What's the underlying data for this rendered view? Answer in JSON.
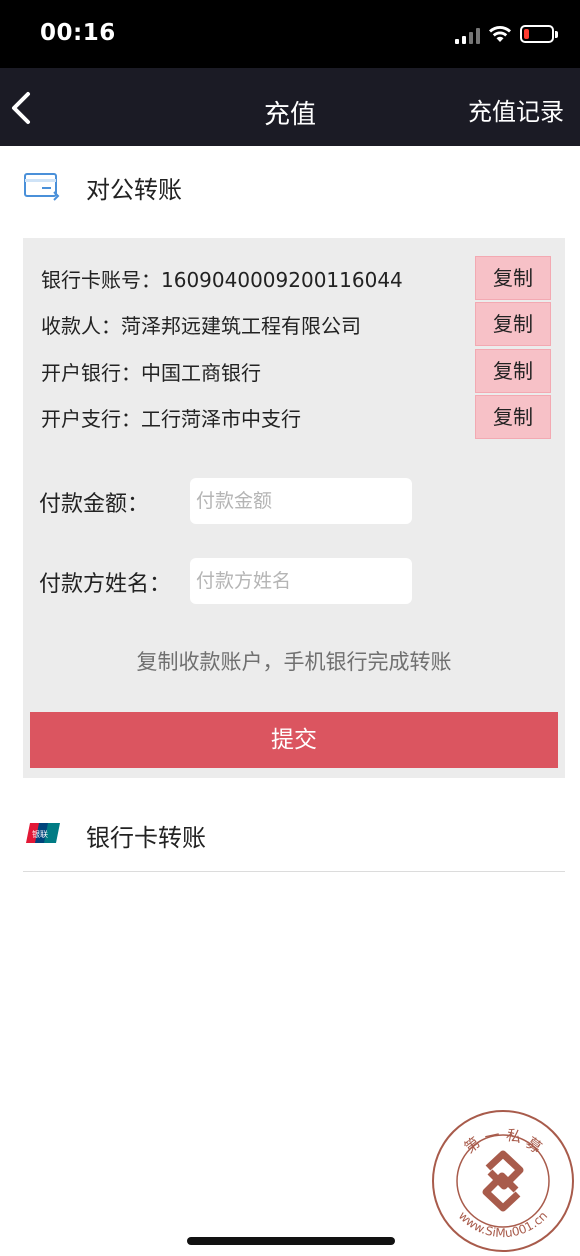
{
  "status_bar": {
    "time": "00:16",
    "battery_color": "#ff3b30"
  },
  "nav": {
    "back_icon": "chevron-left-icon",
    "title": "充值",
    "right_action": "充值记录"
  },
  "corporate_transfer": {
    "icon": "card-transfer-icon",
    "label": "对公转账",
    "rows": [
      {
        "text": "银行卡账号：1609040009200116044",
        "button": "复制"
      },
      {
        "text": "收款人：菏泽邦远建筑工程有限公司",
        "button": "复制"
      },
      {
        "text": "开户银行：中国工商银行",
        "button": "复制"
      },
      {
        "text": "开户支行：工行菏泽市中支行",
        "button": "复制"
      }
    ],
    "amount_label": "付款金额：",
    "amount_placeholder": "付款金额",
    "payer_label": "付款方姓名：",
    "payer_placeholder": "付款方姓名",
    "hint": "复制收款账户，手机银行完成转账",
    "submit": "提交"
  },
  "bank_card_transfer": {
    "icon": "unionpay-icon",
    "label": "银行卡转账",
    "unionpay_text": "银联"
  },
  "watermark": {
    "top_text": "第 一 私 募",
    "bottom_text": "www.SiMu001.cn"
  },
  "colors": {
    "nav_bg": "#1b1b25",
    "copy_btn": "#f7c1c7",
    "submit_bg": "#db5560",
    "panel_bg": "#ececec"
  }
}
